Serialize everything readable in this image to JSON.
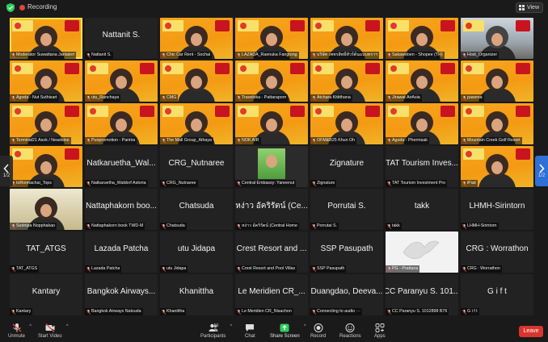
{
  "topbar": {
    "recording_label": "Recording",
    "view_label": "View"
  },
  "pager": {
    "left": "1/2",
    "right": "1/2"
  },
  "rows": [
    [
      {
        "caption": "Moderator Suwattana Jantalert",
        "kind": "cam",
        "active": true
      },
      {
        "caption": "Nattanit S.",
        "kind": "name",
        "big": "Nattanit S."
      },
      {
        "caption": "Chic Car Rent - Sochai",
        "kind": "cam"
      },
      {
        "caption": "LAZADA_Raenuka Fangtong",
        "kind": "cam"
      },
      {
        "caption": "บริษัท เพชรสิทธิ์ทัวร์ต้นแบบทราฯ",
        "kind": "cam"
      },
      {
        "caption": "Sakawdoen - Shopee (TH)",
        "kind": "cam"
      },
      {
        "caption": "Host_Organizer",
        "kind": "room"
      }
    ],
    [
      {
        "caption": "Agoda - Nut Suthisart",
        "kind": "cam"
      },
      {
        "caption": "utu_Ranchaya",
        "kind": "cam"
      },
      {
        "caption": "CMG",
        "kind": "cam"
      },
      {
        "caption": "Traveloka - Pattaraporn",
        "kind": "cam"
      },
      {
        "caption": "Atchara Kititthana",
        "kind": "cam"
      },
      {
        "caption": "Jirawat AirAsia",
        "kind": "cam"
      },
      {
        "caption": "pawena",
        "kind": "cam"
      }
    ],
    [
      {
        "caption": "Terminal21 Asok / Neadsine",
        "kind": "cam"
      },
      {
        "caption": "Punpromotion - Pantira",
        "kind": "cam"
      },
      {
        "caption": "The Mall Group_Athaya",
        "kind": "cam"
      },
      {
        "caption": "NOK AIR",
        "kind": "cam"
      },
      {
        "caption": "OFM&B25 Khun Oh",
        "kind": "cam"
      },
      {
        "caption": "Agoda - Phermsak",
        "kind": "cam"
      },
      {
        "caption": "Mountain Creek Golf Resort",
        "kind": "cam"
      }
    ],
    [
      {
        "caption": "toRonnachai_Tops",
        "kind": "cam"
      },
      {
        "caption": "Natkaruetha_Waldorf Astoria",
        "kind": "name",
        "big": "Natkaruetha_Wal..."
      },
      {
        "caption": "CRG_Nutnaree",
        "kind": "name",
        "big": "CRG_Nutnaree"
      },
      {
        "caption": "Central Embassy: Yaneenut",
        "kind": "green"
      },
      {
        "caption": "Zignature",
        "kind": "name",
        "big": "Zignature"
      },
      {
        "caption": "TAT Tourism Investment Pro",
        "kind": "name",
        "big": "TAT Tourism Inves..."
      },
      {
        "caption": "iPad",
        "kind": "cam"
      }
    ],
    [
      {
        "caption": "Surinipa Nopphakao",
        "kind": "art"
      },
      {
        "caption": "Nattaphakorn book TWD-M",
        "kind": "name",
        "big": "Nattaphakorn boo..."
      },
      {
        "caption": "Chatsuda",
        "kind": "name",
        "big": "Chatsuda"
      },
      {
        "caption": "หง่าว อัคริรัตน์ (Central Home",
        "kind": "name",
        "big": "หง่าว อัคริรัตน์ (Ce..."
      },
      {
        "caption": "Porrutai S.",
        "kind": "name",
        "big": "Porrutai S."
      },
      {
        "caption": "takk",
        "kind": "name",
        "big": "takk"
      },
      {
        "caption": "LHMH-Sirintorn",
        "kind": "name",
        "big": "LHMH-Sirintorn"
      }
    ],
    [
      {
        "caption": "TAT_ATGS",
        "kind": "name",
        "big": "TAT_ATGS"
      },
      {
        "caption": "Lazada Patcha",
        "kind": "name",
        "big": "Lazada Patcha"
      },
      {
        "caption": "utu Jidapa",
        "kind": "name",
        "big": "utu Jidapa"
      },
      {
        "caption": "Crest Resort and Pool Villas",
        "kind": "name",
        "big": "Crest Resort and ..."
      },
      {
        "caption": "SSP Pasupath",
        "kind": "name",
        "big": "SSP Pasupath"
      },
      {
        "caption": "PG - Prattana",
        "kind": "white"
      },
      {
        "caption": "CRG : Worrathon",
        "kind": "name",
        "big": "CRG : Worrathon"
      }
    ],
    [
      {
        "caption": "Kantary",
        "kind": "name",
        "big": "Kantary"
      },
      {
        "caption": "Bangkok Airways Natsuda",
        "kind": "name",
        "big": "Bangkok Airways..."
      },
      {
        "caption": "Khanittha",
        "kind": "name",
        "big": "Khanittha"
      },
      {
        "caption": "Le Meridien CR_Nisachon",
        "kind": "name",
        "big": "Le Meridien CR_..."
      },
      {
        "caption": "Connecting to audio ···",
        "kind": "name",
        "big": "Duangdao, Deeva..."
      },
      {
        "caption": "CC Paranyu S. 1012898 B76",
        "kind": "name",
        "big": "CC Paranyu S. 101..."
      },
      {
        "caption": "G i f t",
        "kind": "name",
        "big": "G i f t"
      }
    ]
  ],
  "toolbar": {
    "unmute": "Unmute",
    "start_video": "Start Video",
    "participants": "Participants",
    "participants_count": "56",
    "chat": "Chat",
    "share_screen": "Share Screen",
    "record": "Record",
    "reactions": "Reactions",
    "apps": "Apps",
    "leave": "Leave"
  },
  "colors": {
    "accent_green": "#2ecc5a",
    "leave_red": "#d9352e",
    "highlight": "#ffe14d",
    "tile_orange": "#f49a12"
  }
}
